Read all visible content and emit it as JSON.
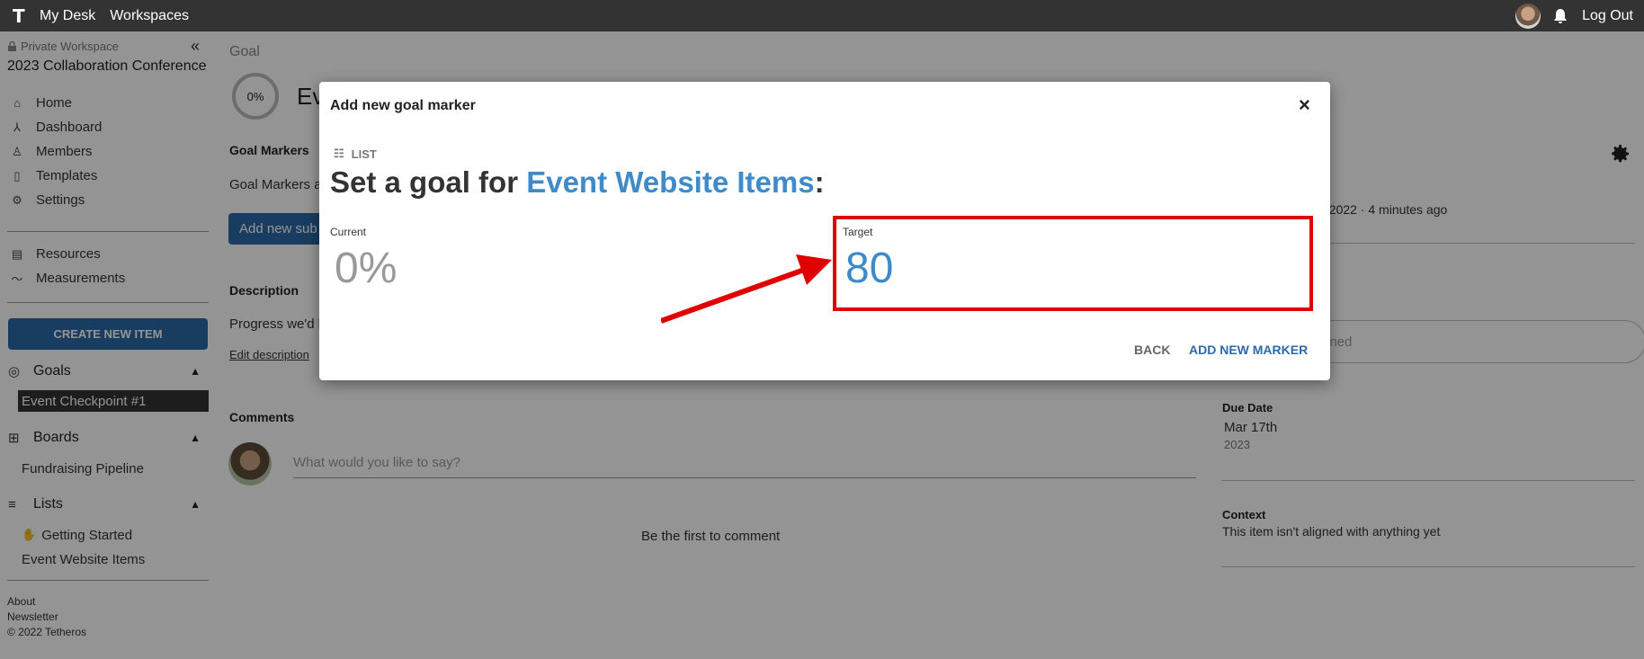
{
  "topbar": {
    "logo": "T",
    "links": [
      "My Desk",
      "Workspaces"
    ],
    "logout": "Log Out"
  },
  "sidebar": {
    "workspace_type": "Private Workspace",
    "workspace_name": "2023 Collaboration Conference",
    "menu": [
      {
        "label": "Home",
        "icon": "home-icon"
      },
      {
        "label": "Dashboard",
        "icon": "dashboard-icon"
      },
      {
        "label": "Members",
        "icon": "members-icon"
      },
      {
        "label": "Templates",
        "icon": "templates-icon"
      },
      {
        "label": "Settings",
        "icon": "settings-icon"
      }
    ],
    "menu2": [
      {
        "label": "Resources",
        "icon": "resources-icon"
      },
      {
        "label": "Measurements",
        "icon": "measurements-icon"
      }
    ],
    "create_button": "CREATE NEW ITEM",
    "sections": {
      "goals": {
        "label": "Goals",
        "items": [
          "Event Checkpoint #1"
        ]
      },
      "boards": {
        "label": "Boards",
        "items": [
          "Fundraising Pipeline"
        ]
      },
      "lists": {
        "label": "Lists",
        "items": [
          "Getting Started",
          "Event Website Items"
        ]
      }
    },
    "footer": [
      "About",
      "Newsletter",
      "© 2022 Tetheros"
    ]
  },
  "main": {
    "goal_label": "Goal",
    "goal_progress": "0%",
    "goal_title_partial": "Ev",
    "goal_markers_heading": "Goal Markers",
    "goal_markers_text": "Goal Markers a",
    "add_sub_button": "Add new sub",
    "description_heading": "Description",
    "description_text": "Progress we'd li",
    "edit_description": "Edit description",
    "comments_heading": "Comments",
    "comment_placeholder": "What would you like to say?",
    "first_comment": "Be the first to comment",
    "updated_text": ", 2022 · 4 minutes ago",
    "assigned_text": "gned",
    "due_date_label": "Due Date",
    "due_date": "Mar 17th",
    "due_year": "2023",
    "context_label": "Context",
    "context_text": "This item isn't aligned with anything yet"
  },
  "modal": {
    "title": "Add new goal marker",
    "close": "×",
    "list_tag": "LIST",
    "heading_prefix": "Set a goal for ",
    "heading_highlight": "Event Website Items",
    "heading_suffix": ":",
    "current_label": "Current",
    "current_value": "0%",
    "target_label": "Target",
    "target_value": "80",
    "back_button": "BACK",
    "add_button": "ADD NEW MARKER"
  },
  "colors": {
    "topbar": "#333333",
    "accent": "#2c6aa8",
    "highlight": "#3f8bc9",
    "annotation_red": "#e00000"
  }
}
